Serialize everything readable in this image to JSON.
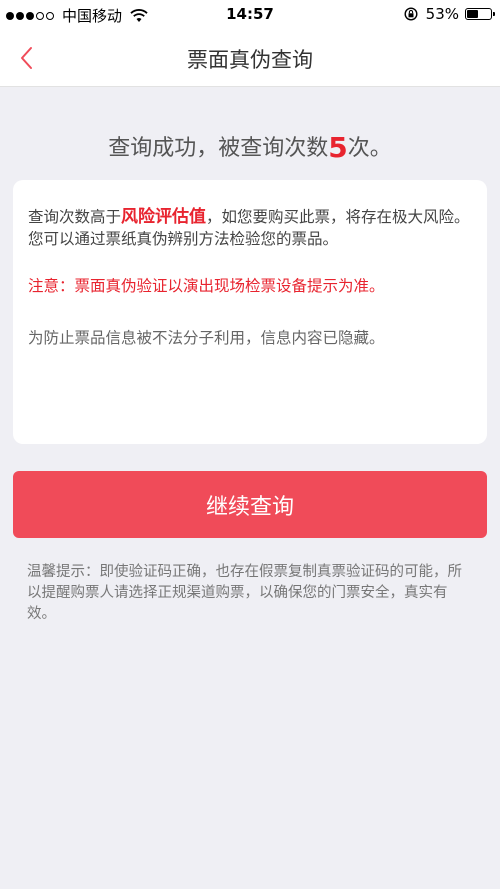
{
  "status_bar": {
    "carrier": "中国移动",
    "time": "14:57",
    "battery": "53%",
    "battery_level": 0.53,
    "signal_strength": 3,
    "signal_max": 5
  },
  "nav": {
    "title": "票面真伪查询",
    "back_icon": "chevron-left-icon"
  },
  "result": {
    "prefix": "查询成功，被查询次数",
    "count": "5",
    "suffix": "次。"
  },
  "card": {
    "line1_prefix": "查询次数高于",
    "line1_risk": "风险评估值",
    "line1_suffix": "，如您要购买此票，将存在极大风险。",
    "line2": "您可以通过票纸真伪辨别方法检验您的票品。",
    "notice": "注意：票面真伪验证以演出现场检票设备提示为准。",
    "hidden_note": "为防止票品信息被不法分子利用，信息内容已隐藏。"
  },
  "continue_button": {
    "label": "继续查询"
  },
  "tips": {
    "text": "温馨提示：即使验证码正确，也存在假票复制真票验证码的可能，所以提醒购票人请选择正规渠道购票，以确保您的门票安全，真实有效。"
  },
  "colors": {
    "accent": "#f04b59",
    "alert": "#e8242f",
    "background": "#efeff4"
  }
}
